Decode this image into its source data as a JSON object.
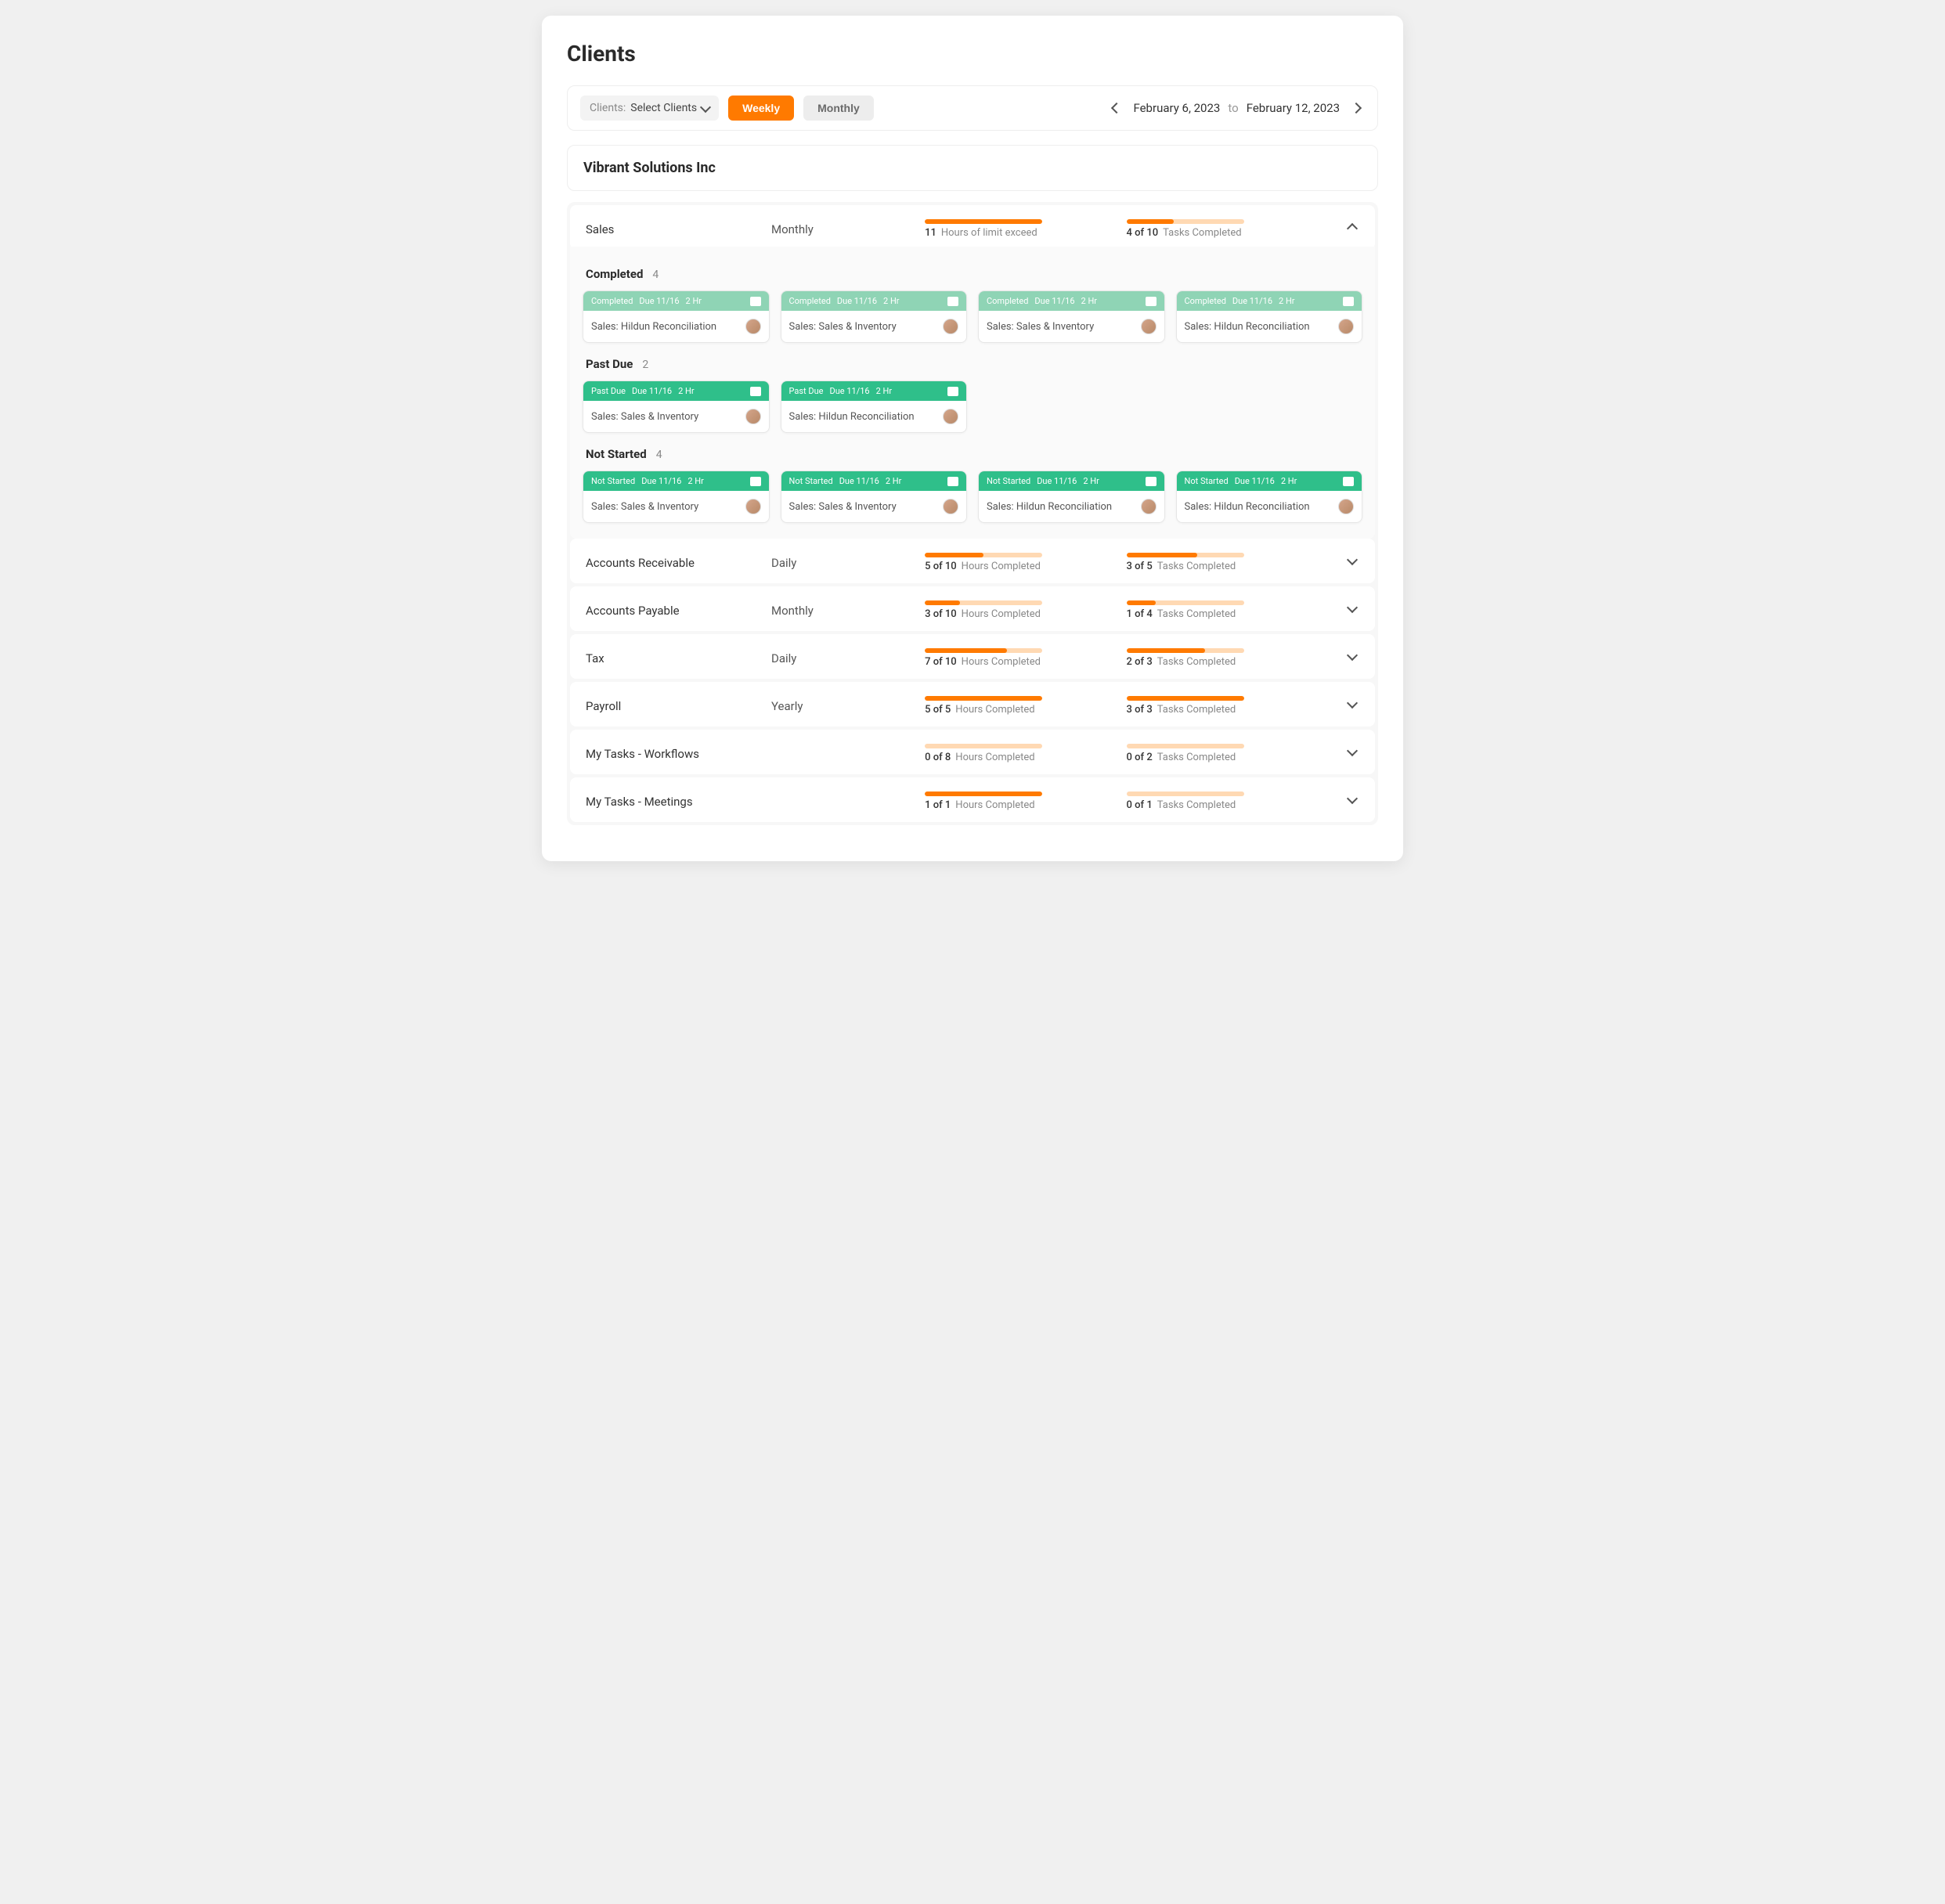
{
  "pageTitle": "Clients",
  "filter": {
    "clientsLabel": "Clients:",
    "clientsValue": "Select Clients",
    "tabs": {
      "weekly": "Weekly",
      "monthly": "Monthly"
    },
    "date": {
      "start": "February 6, 2023",
      "to": "to",
      "end": "February 12, 2023"
    }
  },
  "clientName": "Vibrant Solutions Inc",
  "expanded": {
    "name": "Sales",
    "freq": "Monthly",
    "hours": {
      "num": "11",
      "text": "Hours of limit exceed",
      "pct": 100
    },
    "tasks": {
      "num": "4 of 10",
      "text": "Tasks Completed",
      "pct": 40
    },
    "sections": [
      {
        "title": "Completed",
        "count": "4",
        "style": "completed",
        "cards": [
          {
            "status": "Completed",
            "due": "Due 11/16",
            "hrs": "2 Hr",
            "title": "Sales: Hildun Reconciliation"
          },
          {
            "status": "Completed",
            "due": "Due 11/16",
            "hrs": "2 Hr",
            "title": "Sales: Sales & Inventory"
          },
          {
            "status": "Completed",
            "due": "Due 11/16",
            "hrs": "2 Hr",
            "title": "Sales: Sales & Inventory"
          },
          {
            "status": "Completed",
            "due": "Due 11/16",
            "hrs": "2 Hr",
            "title": "Sales: Hildun Reconciliation"
          }
        ]
      },
      {
        "title": "Past Due",
        "count": "2",
        "style": "pastdue",
        "cards": [
          {
            "status": "Past Due",
            "due": "Due 11/16",
            "hrs": "2 Hr",
            "title": "Sales: Sales & Inventory"
          },
          {
            "status": "Past Due",
            "due": "Due 11/16",
            "hrs": "2 Hr",
            "title": "Sales: Hildun Reconciliation"
          }
        ]
      },
      {
        "title": "Not Started",
        "count": "4",
        "style": "notstarted",
        "cards": [
          {
            "status": "Not Started",
            "due": "Due 11/16",
            "hrs": "2 Hr",
            "title": "Sales: Sales & Inventory"
          },
          {
            "status": "Not Started",
            "due": "Due 11/16",
            "hrs": "2 Hr",
            "title": "Sales: Sales & Inventory"
          },
          {
            "status": "Not Started",
            "due": "Due 11/16",
            "hrs": "2 Hr",
            "title": "Sales: Hildun Reconciliation"
          },
          {
            "status": "Not Started",
            "due": "Due 11/16",
            "hrs": "2 Hr",
            "title": "Sales: Hildun Reconciliation"
          }
        ]
      }
    ]
  },
  "rows": [
    {
      "name": "Accounts Receivable",
      "freq": "Daily",
      "hours": {
        "num": "5 of 10",
        "text": "Hours Completed",
        "pct": 50
      },
      "tasks": {
        "num": "3 of 5",
        "text": "Tasks Completed",
        "pct": 60
      }
    },
    {
      "name": "Accounts Payable",
      "freq": "Monthly",
      "hours": {
        "num": "3 of 10",
        "text": "Hours Completed",
        "pct": 30
      },
      "tasks": {
        "num": "1 of 4",
        "text": "Tasks Completed",
        "pct": 25
      }
    },
    {
      "name": "Tax",
      "freq": "Daily",
      "hours": {
        "num": "7 of 10",
        "text": "Hours Completed",
        "pct": 70
      },
      "tasks": {
        "num": "2 of 3",
        "text": "Tasks Completed",
        "pct": 67
      }
    },
    {
      "name": "Payroll",
      "freq": "Yearly",
      "hours": {
        "num": "5 of 5",
        "text": "Hours Completed",
        "pct": 100
      },
      "tasks": {
        "num": "3 of 3",
        "text": "Tasks Completed",
        "pct": 100
      }
    },
    {
      "name": "My Tasks - Workflows",
      "freq": "",
      "hours": {
        "num": "0 of 8",
        "text": "Hours Completed",
        "pct": 0
      },
      "tasks": {
        "num": "0 of 2",
        "text": "Tasks Completed",
        "pct": 0
      }
    },
    {
      "name": "My Tasks - Meetings",
      "freq": "",
      "hours": {
        "num": "1 of 1",
        "text": "Hours Completed",
        "pct": 100
      },
      "tasks": {
        "num": "0 of 1",
        "text": "Tasks Completed",
        "pct": 0
      }
    }
  ]
}
